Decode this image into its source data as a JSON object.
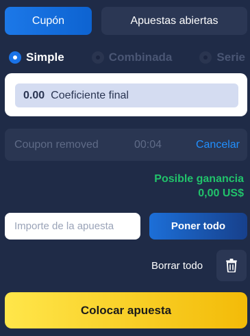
{
  "tabs": {
    "coupon": "Cupón",
    "open_bets": "Apuestas abiertas"
  },
  "bet_type": [
    {
      "label": "Simple",
      "selected": true
    },
    {
      "label": "Combinada",
      "selected": false
    },
    {
      "label": "Serie",
      "selected": false
    }
  ],
  "coefficient": {
    "value": "0.00",
    "label": "Coeficiente final"
  },
  "notice": {
    "text": "Coupon removed",
    "timer": "00:04",
    "cancel": "Cancelar"
  },
  "winnings": {
    "label": "Posible ganancia",
    "value": "0,00 US$"
  },
  "stake": {
    "placeholder": "Importe de la apuesta",
    "value": "",
    "all_in": "Poner todo"
  },
  "clear": {
    "label": "Borrar todo",
    "icon": "trash-icon"
  },
  "place_bet": "Colocar apuesta",
  "colors": {
    "accent": "#1a73e8",
    "success": "#21c36b",
    "cta": "#ffd21f",
    "background": "#1f2b47"
  }
}
